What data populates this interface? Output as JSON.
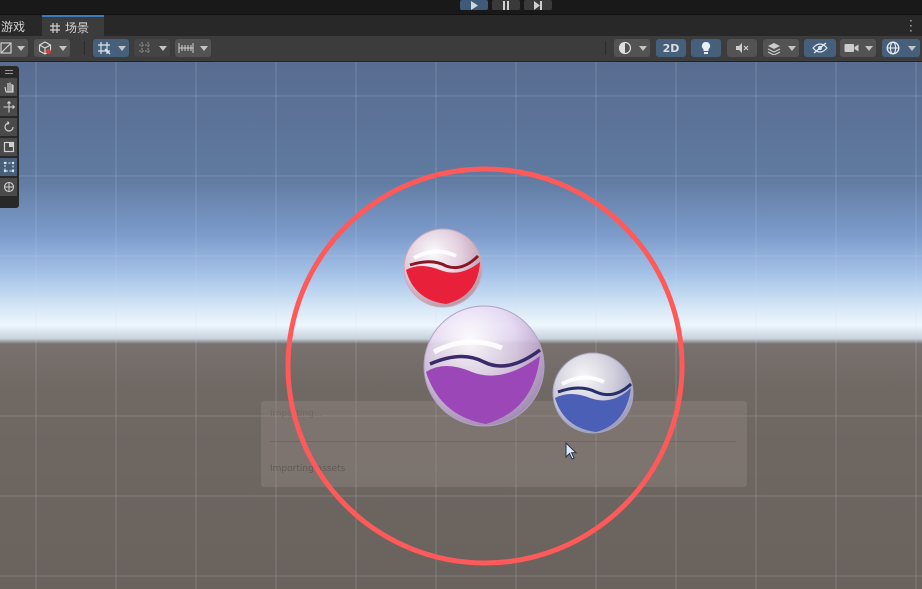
{
  "playbar": {
    "buttons": [
      {
        "name": "play-button",
        "icon": "play-icon",
        "active": true
      },
      {
        "name": "pause-button",
        "icon": "pause-icon",
        "active": false
      },
      {
        "name": "step-button",
        "icon": "step-icon",
        "active": false
      }
    ]
  },
  "tabs": [
    {
      "label": "游戏",
      "icon": "game-icon",
      "active": false
    },
    {
      "label": "场景",
      "icon": "grid-hash-icon",
      "active": true
    }
  ],
  "toolbar": {
    "mode_2d_label": "2D",
    "left_tools": [
      "shading-mode-dropdown",
      "draw-mode-dropdown",
      "grid-snap-toggle",
      "increment-snap-toggle",
      "ruler-snap-toggle"
    ],
    "right_tools": [
      "render-mode-dropdown",
      "2d-toggle",
      "lighting-toggle",
      "audio-toggle",
      "effects-dropdown",
      "visibility-toggle",
      "camera-dropdown",
      "gizmos-dropdown"
    ]
  },
  "tool_panel": {
    "tools": [
      "hand-tool",
      "move-tool",
      "rotate-tool",
      "scale-tool",
      "rect-tool",
      "transform-tool"
    ],
    "active_tool": "rect-tool"
  },
  "scene": {
    "import_overlay": {
      "status_text": "Importing assets",
      "header_text": "Importing..."
    },
    "colors": {
      "circle_collider": "#ff5a5a",
      "marble_red": "#e8203a",
      "marble_purple": "#9c47b8",
      "marble_blue": "#4a5fb5"
    }
  }
}
